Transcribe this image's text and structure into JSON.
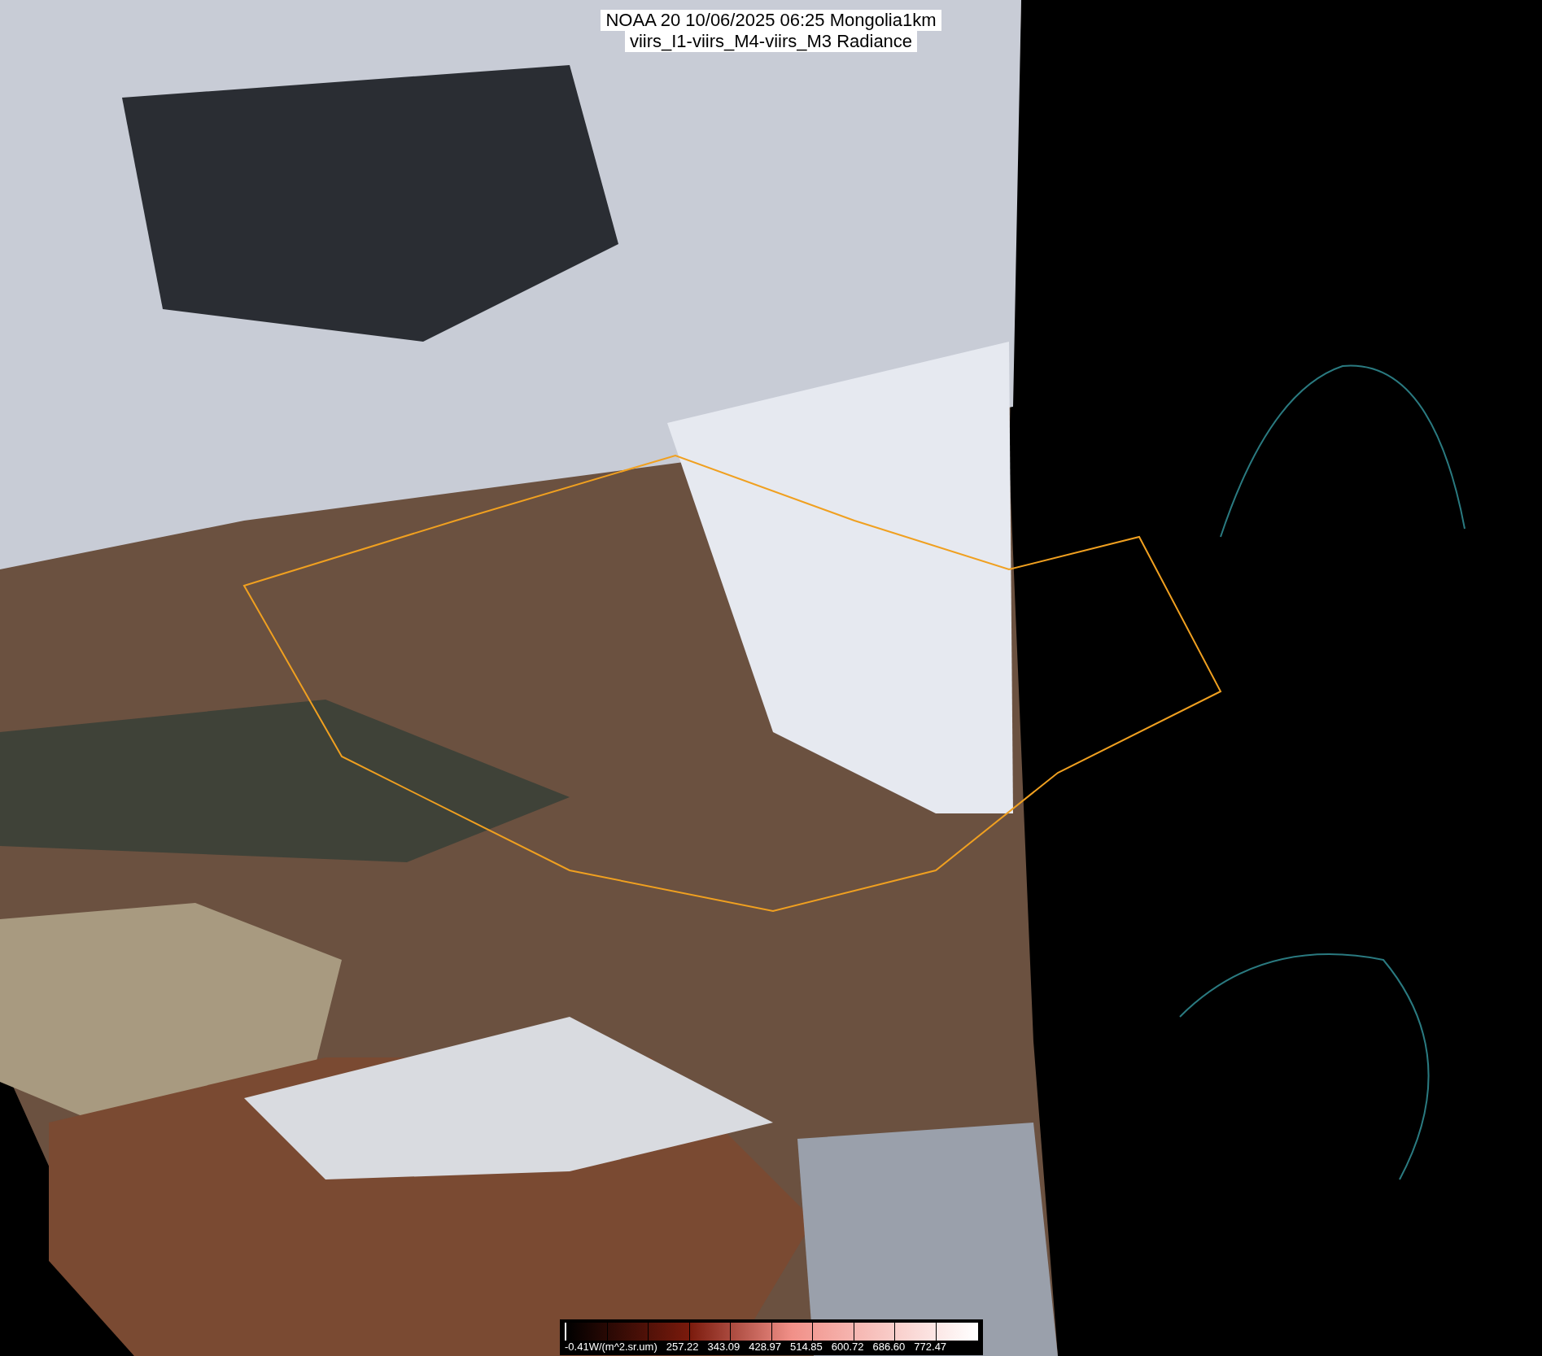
{
  "title": {
    "lines": [
      "NOAA 20 10/06/2025 06:25 Mongolia1km",
      "viirs_I1-viirs_M4-viirs_M3 Radiance"
    ]
  },
  "colorbar": {
    "labels": [
      "-0.41W/(m^2.sr.um)",
      "257.22",
      "343.09",
      "428.97",
      "514.85",
      "600.72",
      "686.60",
      "772.47"
    ]
  }
}
